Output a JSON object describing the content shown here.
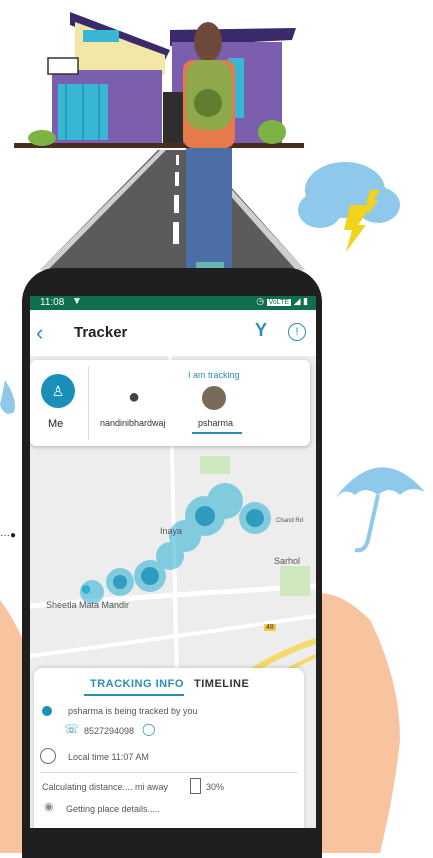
{
  "status_bar": {
    "time": "11:08",
    "icons": [
      "location-icon",
      "alarm-icon",
      "wifi-icon",
      "signal-icon",
      "battery-icon"
    ],
    "wifi_label": "VoLTE"
  },
  "app_bar": {
    "title": "Tracker"
  },
  "tracking_card": {
    "me_label": "Me",
    "section_title": "I am tracking",
    "users": [
      {
        "name": "nandinibhardwaj"
      },
      {
        "name": "psharma"
      }
    ]
  },
  "map": {
    "places": [
      "Inaya",
      "Sarhol",
      "Sheetla Mata Mandir",
      "Chand Rd"
    ],
    "road_badge": "48"
  },
  "tracking_info": {
    "tabs": [
      "TRACKING INFO",
      "TIMELINE"
    ],
    "status": "psharma is being tracked by you",
    "phone": "8527294098",
    "local_time": "Local time 11:07 AM",
    "distance": "Calculating distance.... mi away",
    "battery": "30%",
    "place": "Getting place details....."
  },
  "colors": {
    "accent": "#2a8fb0",
    "status_bar": "#0f6e4e",
    "house_purple": "#7b5fae",
    "cloud_blue": "#8ec8ea",
    "lightning": "#f2d21b"
  }
}
